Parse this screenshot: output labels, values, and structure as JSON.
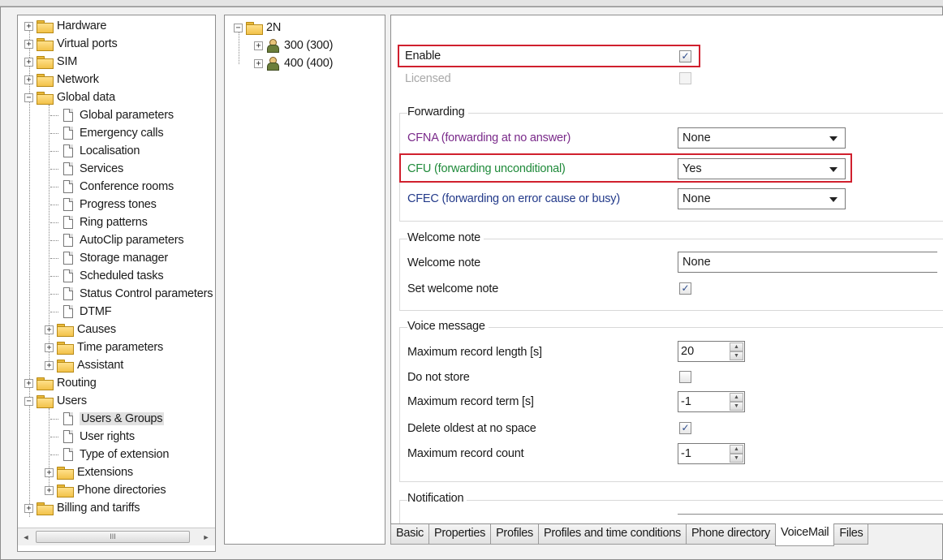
{
  "nav_tree": {
    "items": [
      {
        "label": "Hardware",
        "type": "folder",
        "expander": "+"
      },
      {
        "label": "Virtual ports",
        "type": "folder",
        "expander": "+"
      },
      {
        "label": "SIM",
        "type": "folder",
        "expander": "+"
      },
      {
        "label": "Network",
        "type": "folder",
        "expander": "+"
      },
      {
        "label": "Global data",
        "type": "folder-open",
        "expander": "−"
      },
      {
        "label": "Global parameters",
        "type": "page"
      },
      {
        "label": "Emergency calls",
        "type": "page"
      },
      {
        "label": "Localisation",
        "type": "page"
      },
      {
        "label": "Services",
        "type": "page"
      },
      {
        "label": "Conference rooms",
        "type": "page"
      },
      {
        "label": "Progress tones",
        "type": "page"
      },
      {
        "label": "Ring patterns",
        "type": "page"
      },
      {
        "label": "AutoClip parameters",
        "type": "page"
      },
      {
        "label": "Storage manager",
        "type": "page"
      },
      {
        "label": "Scheduled tasks",
        "type": "page"
      },
      {
        "label": "Status Control parameters",
        "type": "page"
      },
      {
        "label": "DTMF",
        "type": "page"
      },
      {
        "label": "Causes",
        "type": "folder",
        "expander": "+"
      },
      {
        "label": "Time parameters",
        "type": "folder",
        "expander": "+"
      },
      {
        "label": "Assistant",
        "type": "folder",
        "expander": "+"
      },
      {
        "label": "Routing",
        "type": "folder",
        "expander": "+"
      },
      {
        "label": "Users",
        "type": "folder-open",
        "expander": "−"
      },
      {
        "label": "Users & Groups",
        "type": "page",
        "selected": true
      },
      {
        "label": "User rights",
        "type": "page"
      },
      {
        "label": "Type of extension",
        "type": "page"
      },
      {
        "label": "Extensions",
        "type": "folder",
        "expander": "+"
      },
      {
        "label": "Phone directories",
        "type": "folder",
        "expander": "+"
      },
      {
        "label": "Billing and tariffs",
        "type": "folder",
        "expander": "+"
      }
    ],
    "scroll_left": "◄",
    "scroll_right": "►",
    "scroll_grip": "III"
  },
  "group_tree": {
    "root": {
      "label": "2N",
      "expander": "−"
    },
    "children": [
      {
        "label": "300 (300)",
        "expander": "+"
      },
      {
        "label": "400 (400)",
        "expander": "+"
      }
    ]
  },
  "settings": {
    "enable": {
      "label": "Enable",
      "checked": true
    },
    "licensed": {
      "label": "Licensed",
      "checked": false
    },
    "forwarding": {
      "title": "Forwarding",
      "cfna": {
        "label": "CFNA (forwarding at no answer)",
        "value": "None",
        "color": "#7a2a8a"
      },
      "cfu": {
        "label": "CFU (forwarding unconditional)",
        "value": "Yes",
        "color": "#1f8a3a"
      },
      "cfec": {
        "label": "CFEC (forwarding on error cause or busy)",
        "value": "None",
        "color": "#233a8a"
      }
    },
    "welcome": {
      "title": "Welcome note",
      "note": {
        "label": "Welcome note",
        "value": "None"
      },
      "set": {
        "label": "Set welcome note",
        "checked": true
      }
    },
    "voice": {
      "title": "Voice message",
      "max_length": {
        "label": "Maximum record length [s]",
        "value": "20"
      },
      "do_not_store": {
        "label": "Do not store",
        "checked": false
      },
      "max_term": {
        "label": "Maximum record term [s]",
        "value": "-1"
      },
      "delete_oldest": {
        "label": "Delete oldest at no space",
        "checked": true
      },
      "max_count": {
        "label": "Maximum record count",
        "value": "-1"
      }
    },
    "notification": {
      "title": "Notification"
    }
  },
  "tabs": [
    {
      "label": "Basic"
    },
    {
      "label": "Properties"
    },
    {
      "label": "Profiles"
    },
    {
      "label": "Profiles and time conditions"
    },
    {
      "label": "Phone directory"
    },
    {
      "label": "VoiceMail",
      "active": true
    },
    {
      "label": "Files"
    }
  ],
  "glyphs": {
    "check": "✓",
    "spin_up": "▲",
    "spin_down": "▼"
  },
  "colors": {
    "highlight": "#d0202e",
    "folder": "#f2c24a"
  }
}
